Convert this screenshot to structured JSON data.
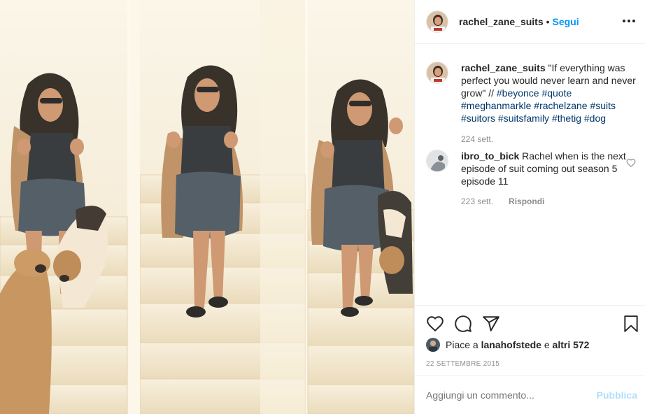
{
  "post": {
    "username": "rachel_zane_suits",
    "separator": "•",
    "follow_label": "Segui",
    "more_icon": "more-horizontal-icon"
  },
  "caption": {
    "username": "rachel_zane_suits",
    "text": "\"If everything was perfect you would never learn and never grow\" //",
    "hashtags": [
      "#beyonce",
      "#quote",
      "#meghanmarkle",
      "#rachelzane",
      "#suits",
      "#suitors",
      "#suitsfamily",
      "#thetig",
      "#dog"
    ],
    "time": "224 sett."
  },
  "comments": [
    {
      "username": "ibro_to_bick",
      "text": "Rachel when is the next episode of suit coming out season 5 episode 11",
      "time": "223 sett.",
      "reply_label": "Rispondi"
    }
  ],
  "actions": {
    "icons": [
      "heart-icon",
      "comment-icon",
      "share-icon",
      "bookmark-icon"
    ]
  },
  "likes": {
    "prefix": "Piace a",
    "user": "lanahofstede",
    "joiner": "e",
    "others": "altri 572"
  },
  "date": "22 settembre 2015",
  "add_comment": {
    "placeholder": "Aggiungi un commento...",
    "post_label": "Pubblica"
  },
  "colors": {
    "accent": "#0095f6",
    "hashtag": "#00376b",
    "muted": "#8e8e8e",
    "post_disabled": "#b2dffc"
  }
}
